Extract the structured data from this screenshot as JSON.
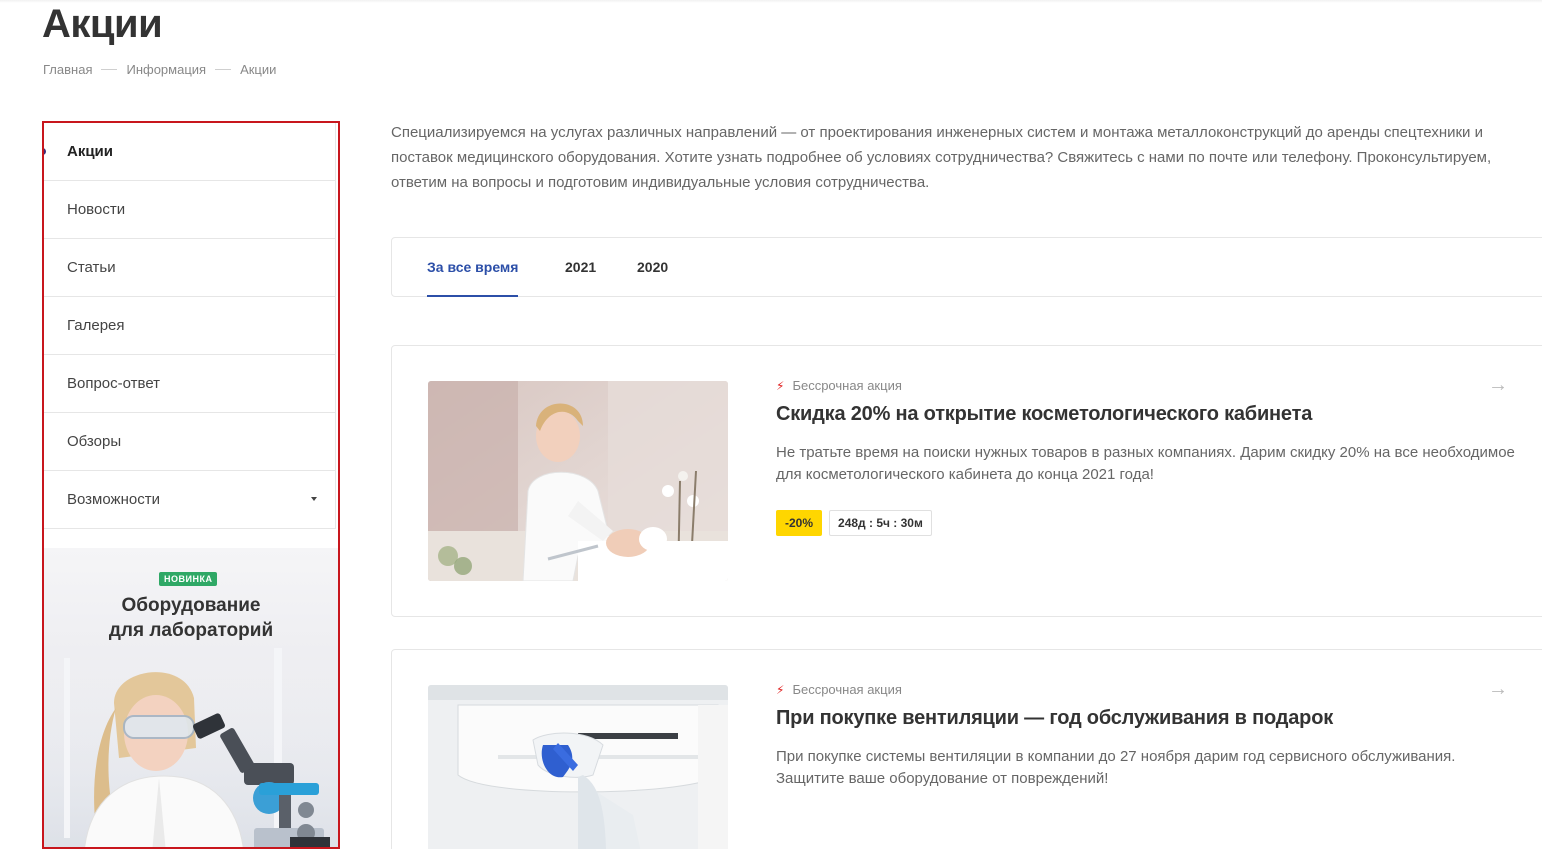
{
  "page": {
    "title": "Акции"
  },
  "breadcrumb": [
    "Главная",
    "Информация",
    "Акции"
  ],
  "sidebar": {
    "items": [
      {
        "label": "Акции",
        "active": true
      },
      {
        "label": "Новости"
      },
      {
        "label": "Статьи"
      },
      {
        "label": "Галерея"
      },
      {
        "label": "Вопрос-ответ"
      },
      {
        "label": "Обзоры"
      },
      {
        "label": "Возможности",
        "has_submenu": true
      }
    ],
    "banner": {
      "badge": "НОВИНКА",
      "title_line1": "Оборудование",
      "title_line2": "для лабораторий"
    }
  },
  "intro": "Специализируемся на услугах различных направлений — от проектирования инженерных систем и монтажа металлоконструкций до аренды спецтехники и поставок медицинского оборудования. Хотите узнать подробнее об условиях сотрудничества? Свяжитесь с нами по почте или телефону. Проконсультируем, ответим на вопросы и подготовим индивидуальные условия сотрудничества.",
  "tabs": [
    {
      "label": "За все время",
      "active": true
    },
    {
      "label": "2021"
    },
    {
      "label": "2020"
    }
  ],
  "promos": [
    {
      "tag": "Бессрочная акция",
      "title": "Скидка 20% на открытие косметологического кабинета",
      "description": "Не тратьте время на поиски нужных товаров в разных компаниях. Дарим скидку 20% на все необходимое для косметологического кабинета до конца 2021 года!",
      "discount": "-20%",
      "timer": "248д : 5ч : 30м"
    },
    {
      "tag": "Бессрочная акция",
      "title": "При покупке вентиляции — год обслуживания в подарок",
      "description": "При покупке системы вентиляции в компании до 27 ноября дарим год сервисного обслуживания. Защитите ваше оборудование от повреждений!"
    }
  ],
  "colors": {
    "accent": "#2c4fa8",
    "highlight_border": "#c8161d",
    "discount_bg": "#ffd600",
    "badge_green": "#2fa866",
    "bolt": "#e02020"
  },
  "icons": {
    "promo_tag": "lightning-icon",
    "promo_link": "arrow-right-icon",
    "submenu": "caret-down-icon"
  }
}
